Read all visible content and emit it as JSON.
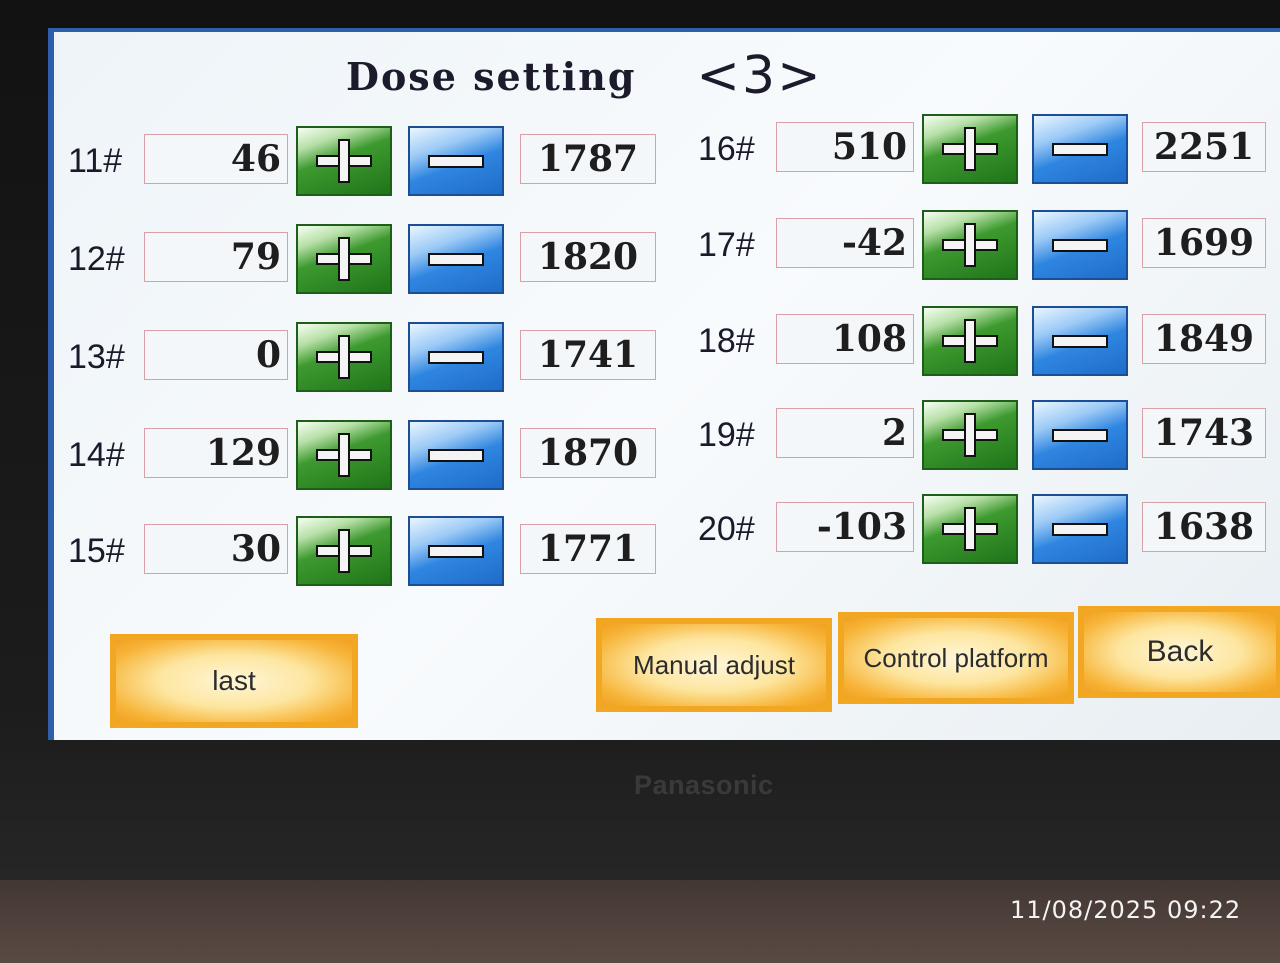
{
  "screen": {
    "title": "Dose setting",
    "page_indicator": "<3>"
  },
  "left_rows": [
    {
      "id": "11#",
      "value": "46",
      "total": "1787"
    },
    {
      "id": "12#",
      "value": "79",
      "total": "1820"
    },
    {
      "id": "13#",
      "value": "0",
      "total": "1741"
    },
    {
      "id": "14#",
      "value": "129",
      "total": "1870"
    },
    {
      "id": "15#",
      "value": "30",
      "total": "1771"
    }
  ],
  "right_rows": [
    {
      "id": "16#",
      "value": "510",
      "total": "2251"
    },
    {
      "id": "17#",
      "value": "-42",
      "total": "1699"
    },
    {
      "id": "18#",
      "value": "108",
      "total": "1849"
    },
    {
      "id": "19#",
      "value": "2",
      "total": "1743"
    },
    {
      "id": "20#",
      "value": "-103",
      "total": "1638"
    }
  ],
  "buttons": {
    "last": "last",
    "manual_adjust": "Manual adjust",
    "control_platform": "Control platform",
    "back": "Back"
  },
  "device": {
    "brand": "Panasonic"
  },
  "photo_timestamp": "11/08/2025 09:22",
  "icons": {
    "plus": "plus-icon",
    "minus": "minus-icon"
  },
  "colors": {
    "plus_button": "#2f8a25",
    "minus_button": "#2f86e0",
    "soft_button": "#f2a722",
    "frame_border": "#2e5fa8"
  }
}
